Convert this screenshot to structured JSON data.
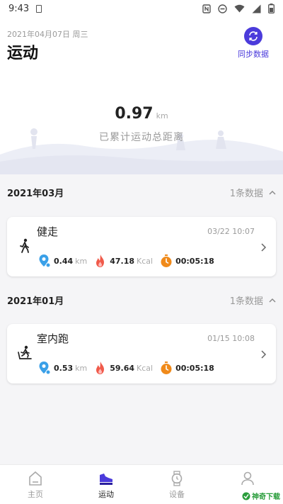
{
  "status": {
    "time": "9:43"
  },
  "header": {
    "date": "2021年04月07日 周三",
    "title": "运动",
    "sync_label": "同步数据"
  },
  "summary": {
    "value": "0.97",
    "unit": "km",
    "label": "已累计运动总距离"
  },
  "groups": [
    {
      "month": "2021年03月",
      "count": "1条数据",
      "record": {
        "name": "健走",
        "time": "03/22 10:07",
        "distance": "0.44",
        "distance_unit": "km",
        "calories": "47.18",
        "calories_unit": "Kcal",
        "duration": "00:05:18"
      }
    },
    {
      "month": "2021年01月",
      "count": "1条数据",
      "record": {
        "name": "室内跑",
        "time": "01/15 10:08",
        "distance": "0.53",
        "distance_unit": "km",
        "calories": "59.64",
        "calories_unit": "Kcal",
        "duration": "00:05:18"
      }
    }
  ],
  "tabs": [
    {
      "label": "主页",
      "icon": "home-icon",
      "active": false
    },
    {
      "label": "运动",
      "icon": "shoe-icon",
      "active": true
    },
    {
      "label": "设备",
      "icon": "watch-icon",
      "active": false
    },
    {
      "label": "",
      "icon": "profile-icon",
      "active": false
    }
  ],
  "watermark": {
    "text": "神奇下载"
  },
  "colors": {
    "accent": "#4b3bdb",
    "distance": "#3aa0e8",
    "calories": "#f05a4a",
    "duration": "#f08a1a"
  }
}
